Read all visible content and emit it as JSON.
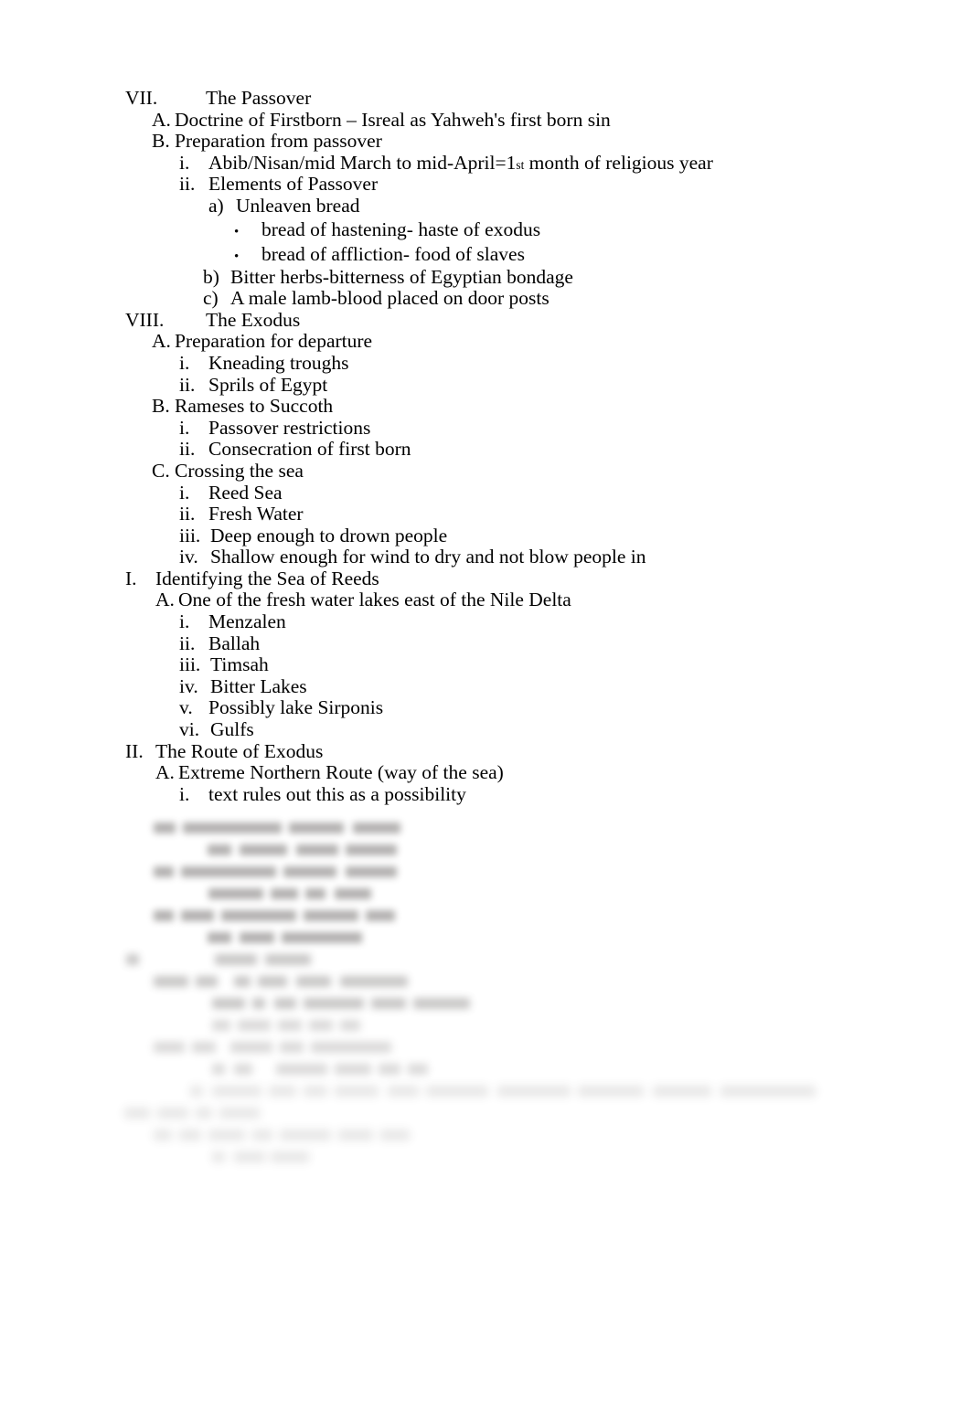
{
  "document": {
    "type": "outline-notes",
    "background_color": "#ffffff",
    "text_color": "#000000",
    "font_style": "serif",
    "legible_lines": [
      {
        "level": "roman",
        "marker": "VII.",
        "text": "The Passover"
      },
      {
        "level": "alpha",
        "marker": "A.",
        "text": "Doctrine of Firstborn – Isreal as Yahweh's first born sin"
      },
      {
        "level": "alpha",
        "marker": "B.",
        "text": "Preparation from passover"
      },
      {
        "level": "lower",
        "marker": "i.",
        "text": "Abib/Nisan/mid March to mid-April=1",
        "sup": "st",
        "text_after": " month of religious year"
      },
      {
        "level": "lower",
        "marker": "ii.",
        "text": "Elements of Passover"
      },
      {
        "level": "paren",
        "marker": "a)",
        "text": "Unleaven bread"
      },
      {
        "level": "bullet",
        "marker": "•",
        "text": "bread of hastening- haste of exodus"
      },
      {
        "level": "bullet",
        "marker": "•",
        "text": "bread of affliction- food of slaves"
      },
      {
        "level": "paren2",
        "marker": "b)",
        "text": "Bitter herbs-bitterness of Egyptian bondage"
      },
      {
        "level": "paren2",
        "marker": "c)",
        "text": "A male lamb-blood placed on door posts"
      },
      {
        "level": "roman",
        "marker": "VIII.",
        "text": "The Exodus"
      },
      {
        "level": "alpha",
        "marker": "A.",
        "text": "Preparation for departure"
      },
      {
        "level": "lower",
        "marker": "i.",
        "text": "Kneading troughs"
      },
      {
        "level": "lower",
        "marker": "ii.",
        "text": "Sprils of Egypt"
      },
      {
        "level": "alpha",
        "marker": "B.",
        "text": "Rameses to Succoth"
      },
      {
        "level": "lower",
        "marker": "i.",
        "text": "Passover restrictions"
      },
      {
        "level": "lower",
        "marker": "ii.",
        "text": "Consecration of first born"
      },
      {
        "level": "alpha",
        "marker": "C.",
        "text": "Crossing the sea"
      },
      {
        "level": "lower",
        "marker": "i.",
        "text": "Reed Sea"
      },
      {
        "level": "lower",
        "marker": "ii.",
        "text": "Fresh Water"
      },
      {
        "level": "lower",
        "marker": "iii.",
        "text": "Deep enough to drown people"
      },
      {
        "level": "lower",
        "marker": "iv.",
        "text": "Shallow enough for wind to dry and not blow people in"
      },
      {
        "level": "roman-nar",
        "marker": "I.",
        "text": "Identifying the Sea of Reeds"
      },
      {
        "level": "alpha2",
        "marker": "A.",
        "text": "One of the fresh water lakes east of the Nile Delta"
      },
      {
        "level": "lower",
        "marker": "i.",
        "text": "Menzalen"
      },
      {
        "level": "lower",
        "marker": "ii.",
        "text": "Ballah"
      },
      {
        "level": "lower",
        "marker": "iii.",
        "text": "Timsah"
      },
      {
        "level": "lower",
        "marker": "iv.",
        "text": "Bitter Lakes"
      },
      {
        "level": "lower",
        "marker": "v.",
        "text": "Possibly lake Sirponis"
      },
      {
        "level": "lower",
        "marker": "vi.",
        "text": "Gulfs"
      },
      {
        "level": "roman-nar",
        "marker": "II.",
        "text": "The Route of Exodus"
      },
      {
        "level": "alpha2",
        "marker": "A.",
        "text": "Extreme Northern Route (way of the sea)"
      },
      {
        "level": "lower",
        "marker": "i.",
        "text": "text rules out this as a possibility"
      }
    ],
    "illegible_tail": {
      "note": "Remaining outline lines are blurred past legibility in the source image.",
      "line_count": 16
    }
  }
}
